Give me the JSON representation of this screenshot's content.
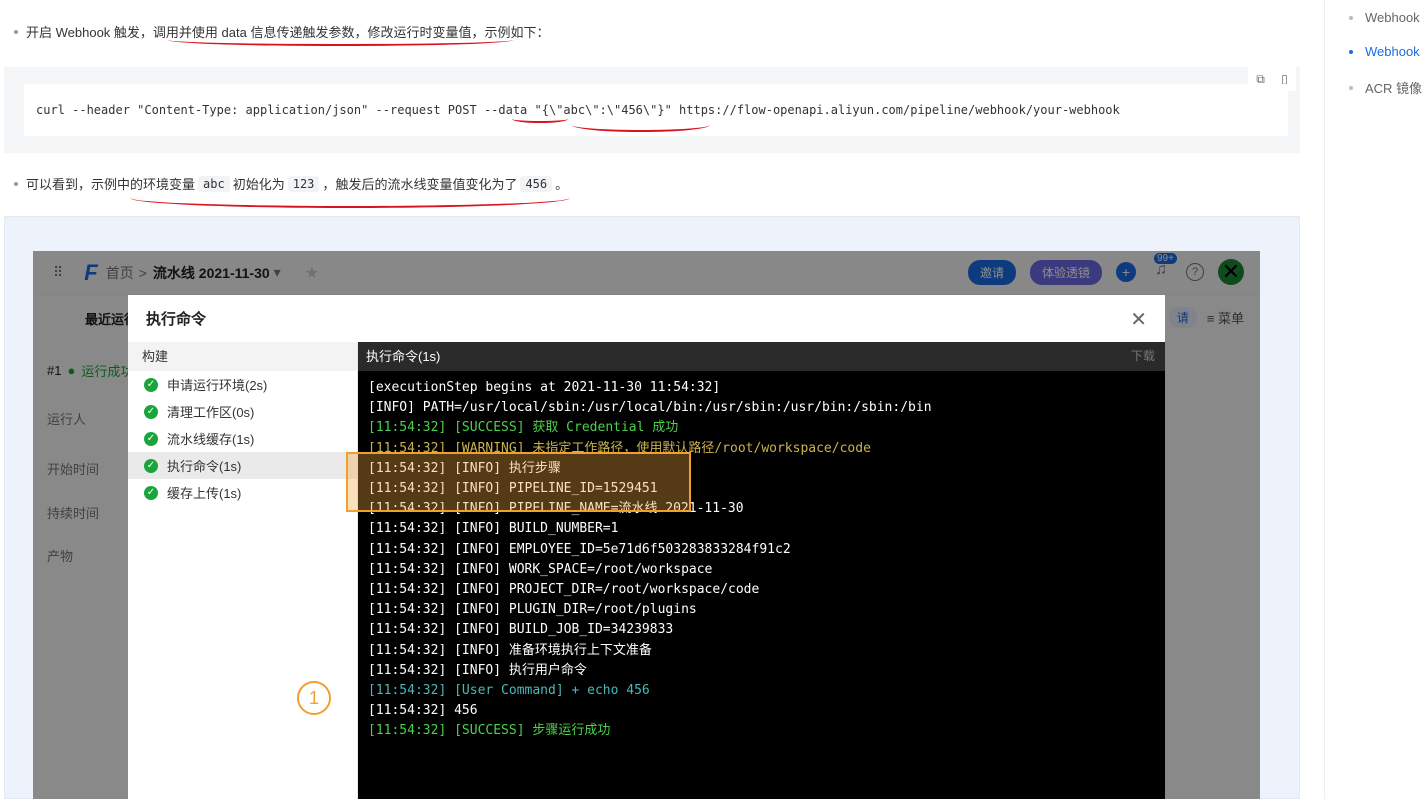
{
  "article": {
    "p1": {
      "a": "开启 Webhook 触发，",
      "b": "调用并使用 data 信息传递触发参数，修改运行时变量值",
      "c": "，示例如下："
    },
    "code": {
      "pre": "curl --header \"Content-Type: application/json\" --request POST ",
      "data_flag": "--data",
      "data_val": "\"{\\\"abc\\\":\\\"456\\\"}\"",
      "post": " https://flow-openapi.aliyun.com/pipeline/webhook/your-webhook"
    },
    "p2": {
      "a": "可以看到，",
      "b": "示例中的环境变量",
      "var": "abc",
      "c": "初始化为",
      "v1": "123",
      "d": "，",
      "e": "触发后的流水线变量值变化为了",
      "v2": "456",
      "f": "。"
    }
  },
  "app": {
    "crumb_home": "首页",
    "crumb_sep": ">",
    "crumb_current": "流水线 2021-11-30",
    "invite": "邀请",
    "experience": "体验透镜",
    "notif_count": "99+",
    "bg_tab": "最近运行",
    "bg_run_no": "#1",
    "bg_run_status": "运行成功",
    "bg_labels": [
      "运行人",
      "开始时间",
      "持续时间",
      "产物"
    ],
    "bg_right_pill": "请",
    "bg_menu": "≡ 菜单"
  },
  "modal": {
    "title": "执行命令",
    "left_head": "构建",
    "steps": [
      {
        "label": "申请运行环境(2s)"
      },
      {
        "label": "清理工作区(0s)"
      },
      {
        "label": "流水线缓存(1s)"
      },
      {
        "label": "执行命令(1s)"
      },
      {
        "label": "缓存上传(1s)"
      }
    ],
    "right_head": "执行命令(1s)",
    "download": "下载",
    "log": [
      {
        "t": "[executionStep begins at 2021-11-30 11:54:32]",
        "c": "w"
      },
      {
        "t": "[INFO] PATH=/usr/local/sbin:/usr/local/bin:/usr/sbin:/usr/bin:/sbin:/bin",
        "c": "w"
      },
      {
        "t": "[11:54:32] [SUCCESS] 获取 Credential 成功",
        "c": "g"
      },
      {
        "t": "[11:54:32] [WARNING] 未指定工作路径，使用默认路径/root/workspace/code",
        "c": "y"
      },
      {
        "t": "[11:54:32] [INFO] 执行步骤",
        "c": "w"
      },
      {
        "t": "[11:54:32] [INFO] PIPELINE_ID=1529451",
        "c": "w"
      },
      {
        "t": "[11:54:32] [INFO] PIPELINE_NAME=流水线 2021-11-30",
        "c": "w"
      },
      {
        "t": "[11:54:32] [INFO] BUILD_NUMBER=1",
        "c": "w"
      },
      {
        "t": "[11:54:32] [INFO] EMPLOYEE_ID=5e71d6f503283833284f91c2",
        "c": "w"
      },
      {
        "t": "[11:54:32] [INFO] WORK_SPACE=/root/workspace",
        "c": "w"
      },
      {
        "t": "[11:54:32] [INFO] PROJECT_DIR=/root/workspace/code",
        "c": "w"
      },
      {
        "t": "[11:54:32] [INFO] PLUGIN_DIR=/root/plugins",
        "c": "w"
      },
      {
        "t": "[11:54:32] [INFO] BUILD_JOB_ID=34239833",
        "c": "w"
      },
      {
        "t": "[11:54:32] [INFO] 准备环境执行上下文准备",
        "c": "w"
      },
      {
        "t": "[11:54:32] [INFO] 执行用户命令",
        "c": "w"
      },
      {
        "t": "[11:54:32] [User Command] + echo 456",
        "c": "c"
      },
      {
        "t": "[11:54:32] 456",
        "c": "w"
      },
      {
        "t": "[11:54:32] [SUCCESS] 步骤运行成功",
        "c": "g"
      }
    ]
  },
  "annotation": {
    "number": "1"
  },
  "toc": {
    "items": [
      {
        "label": "Webhook",
        "active": false
      },
      {
        "label": "Webhook",
        "active": true
      },
      {
        "label": "ACR 镜像",
        "active": false
      }
    ]
  }
}
